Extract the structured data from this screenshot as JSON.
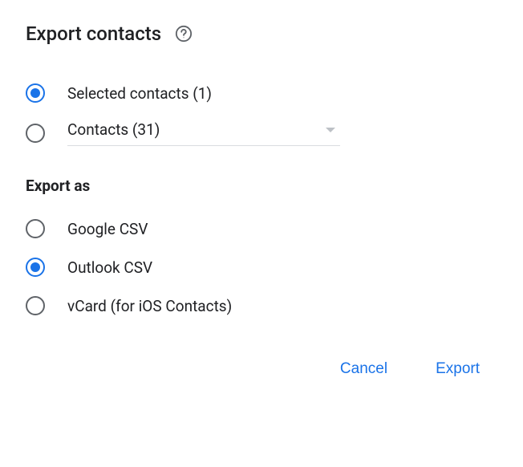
{
  "dialog": {
    "title": "Export contacts"
  },
  "source": {
    "options": [
      {
        "label": "Selected contacts (1)",
        "selected": true
      },
      {
        "label": "Contacts (31)",
        "selected": false
      }
    ]
  },
  "export_as": {
    "label": "Export as",
    "options": [
      {
        "label": "Google CSV",
        "selected": false
      },
      {
        "label": "Outlook CSV",
        "selected": true
      },
      {
        "label": "vCard (for iOS Contacts)",
        "selected": false
      }
    ]
  },
  "actions": {
    "cancel": "Cancel",
    "export": "Export"
  }
}
